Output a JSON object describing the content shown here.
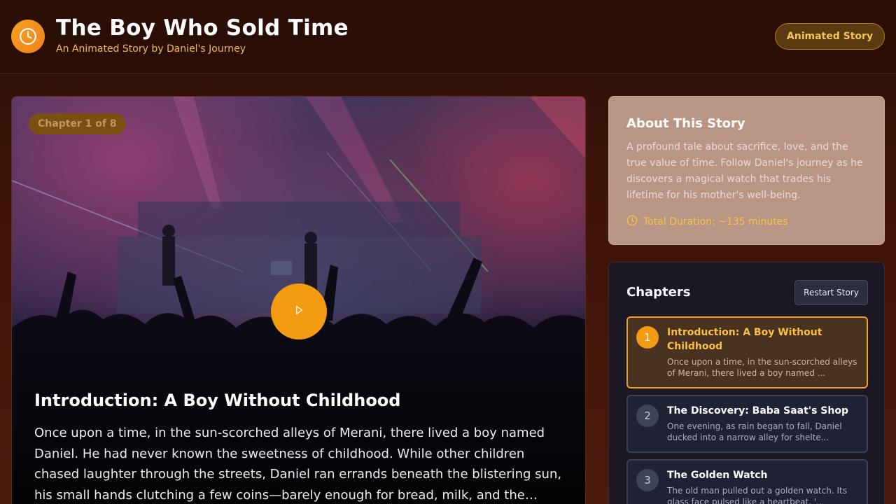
{
  "header": {
    "logo_icon": "clock-icon",
    "title": "The Boy Who Sold Time",
    "subtitle": "An Animated Story by Daniel's Journey",
    "badge": "Animated Story"
  },
  "player": {
    "chapter_label": "Chapter 1 of 8",
    "play_icon": "play-icon",
    "chapter_title": "Introduction: A Boy Without Childhood",
    "chapter_text": "Once upon a time, in the sun-scorched alleys of Merani, there lived a boy named Daniel. He had never known the sweetness of childhood. While other children chased laughter through the streets, Daniel ran errands beneath the blistering sun, his small hands clutching a few coins—barely enough for bread, milk, and the…"
  },
  "about": {
    "title": "About This Story",
    "description": "A profound tale about sacrifice, love, and the true value of time. Follow Daniel's journey as he discovers a magical watch that trades his lifetime for his mother's well-being.",
    "duration_icon": "clock-icon",
    "duration": "Total Duration: ~135 minutes"
  },
  "chapters": {
    "title": "Chapters",
    "restart_label": "Restart Story",
    "items": [
      {
        "number": "1",
        "title": "Introduction: A Boy Without Childhood",
        "description": "Once upon a time, in the sun-scorched alleys of Merani, there lived a boy named ..."
      },
      {
        "number": "2",
        "title": "The Discovery: Baba Saat's Shop",
        "description": "One evening, as rain began to fall, Daniel ducked into a narrow alley for shelte..."
      },
      {
        "number": "3",
        "title": "The Golden Watch",
        "description": "The old man pulled out a golden watch. Its glass face pulsed like a heartbeat. '..."
      }
    ]
  },
  "colors": {
    "accent": "#f39c12",
    "header_bg": "#2b0e05",
    "panel_bg": "#1b1824"
  }
}
